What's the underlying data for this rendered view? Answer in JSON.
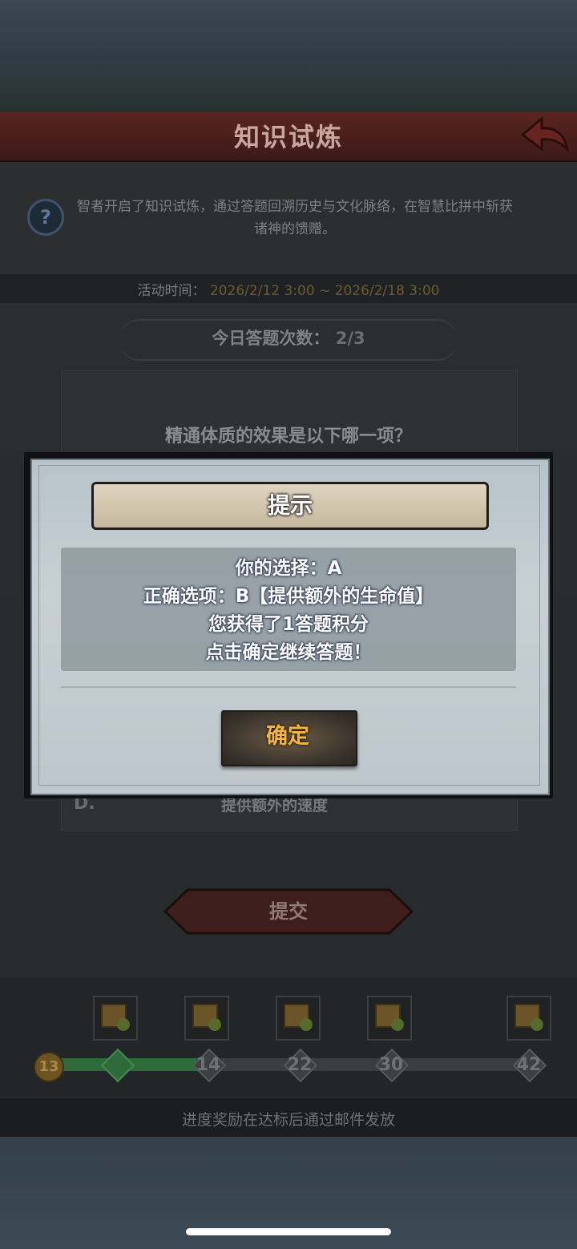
{
  "header": {
    "title": "知识试炼"
  },
  "intro": {
    "text": "智者开启了知识试炼，通过答题回溯历史与文化脉络，在智慧比拼中斩获诸神的馈赠。"
  },
  "activity_time": {
    "label": "活动时间：",
    "value": "2026/2/12 3:00 ~ 2026/2/18 3:00"
  },
  "daily_count": {
    "label": "今日答题次数：",
    "value": "2/3"
  },
  "question": {
    "text": "精通体质的效果是以下哪一项？",
    "visible_option": {
      "letter": "D.",
      "text": "提供额外的速度"
    }
  },
  "submit": {
    "label": "提交"
  },
  "progress": {
    "current_level": "13",
    "progress_percent": 31,
    "milestones": [
      "14",
      "22",
      "30",
      "42"
    ]
  },
  "footer": {
    "note": "进度奖励在达标后通过邮件发放"
  },
  "dialog": {
    "title": "提示",
    "lines": [
      "你的选择：A",
      "正确选项：B【提供额外的生命值】",
      "您获得了1答题积分",
      "点击确定继续答题！"
    ],
    "confirm_label": "确定"
  },
  "icons": {
    "back": "back-arrow-icon",
    "info": "question-mark-icon",
    "reward": "chest-and-bag-icon",
    "check": "checkmark-icon"
  },
  "colors": {
    "title_bar": "#5a2520",
    "progress_fill": "#2f6b3a",
    "confirm_text": "#f3b545"
  }
}
